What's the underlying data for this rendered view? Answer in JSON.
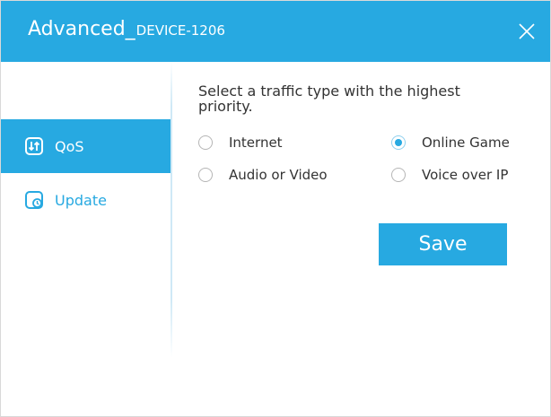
{
  "window": {
    "title": "Advanced_",
    "title_suffix": "DEVICE-1206",
    "accent_color": "#27a9e1"
  },
  "sidebar": {
    "items": [
      {
        "label": "QoS",
        "icon": "qos-icon",
        "active": true
      },
      {
        "label": "Update",
        "icon": "update-icon",
        "active": false
      }
    ]
  },
  "qos": {
    "prompt": "Select a traffic type with the highest priority.",
    "options": [
      {
        "label": "Internet",
        "checked": false
      },
      {
        "label": "Online Game",
        "checked": true
      },
      {
        "label": "Audio or Video",
        "checked": false
      },
      {
        "label": "Voice over IP",
        "checked": false
      }
    ],
    "save_label": "Save"
  }
}
